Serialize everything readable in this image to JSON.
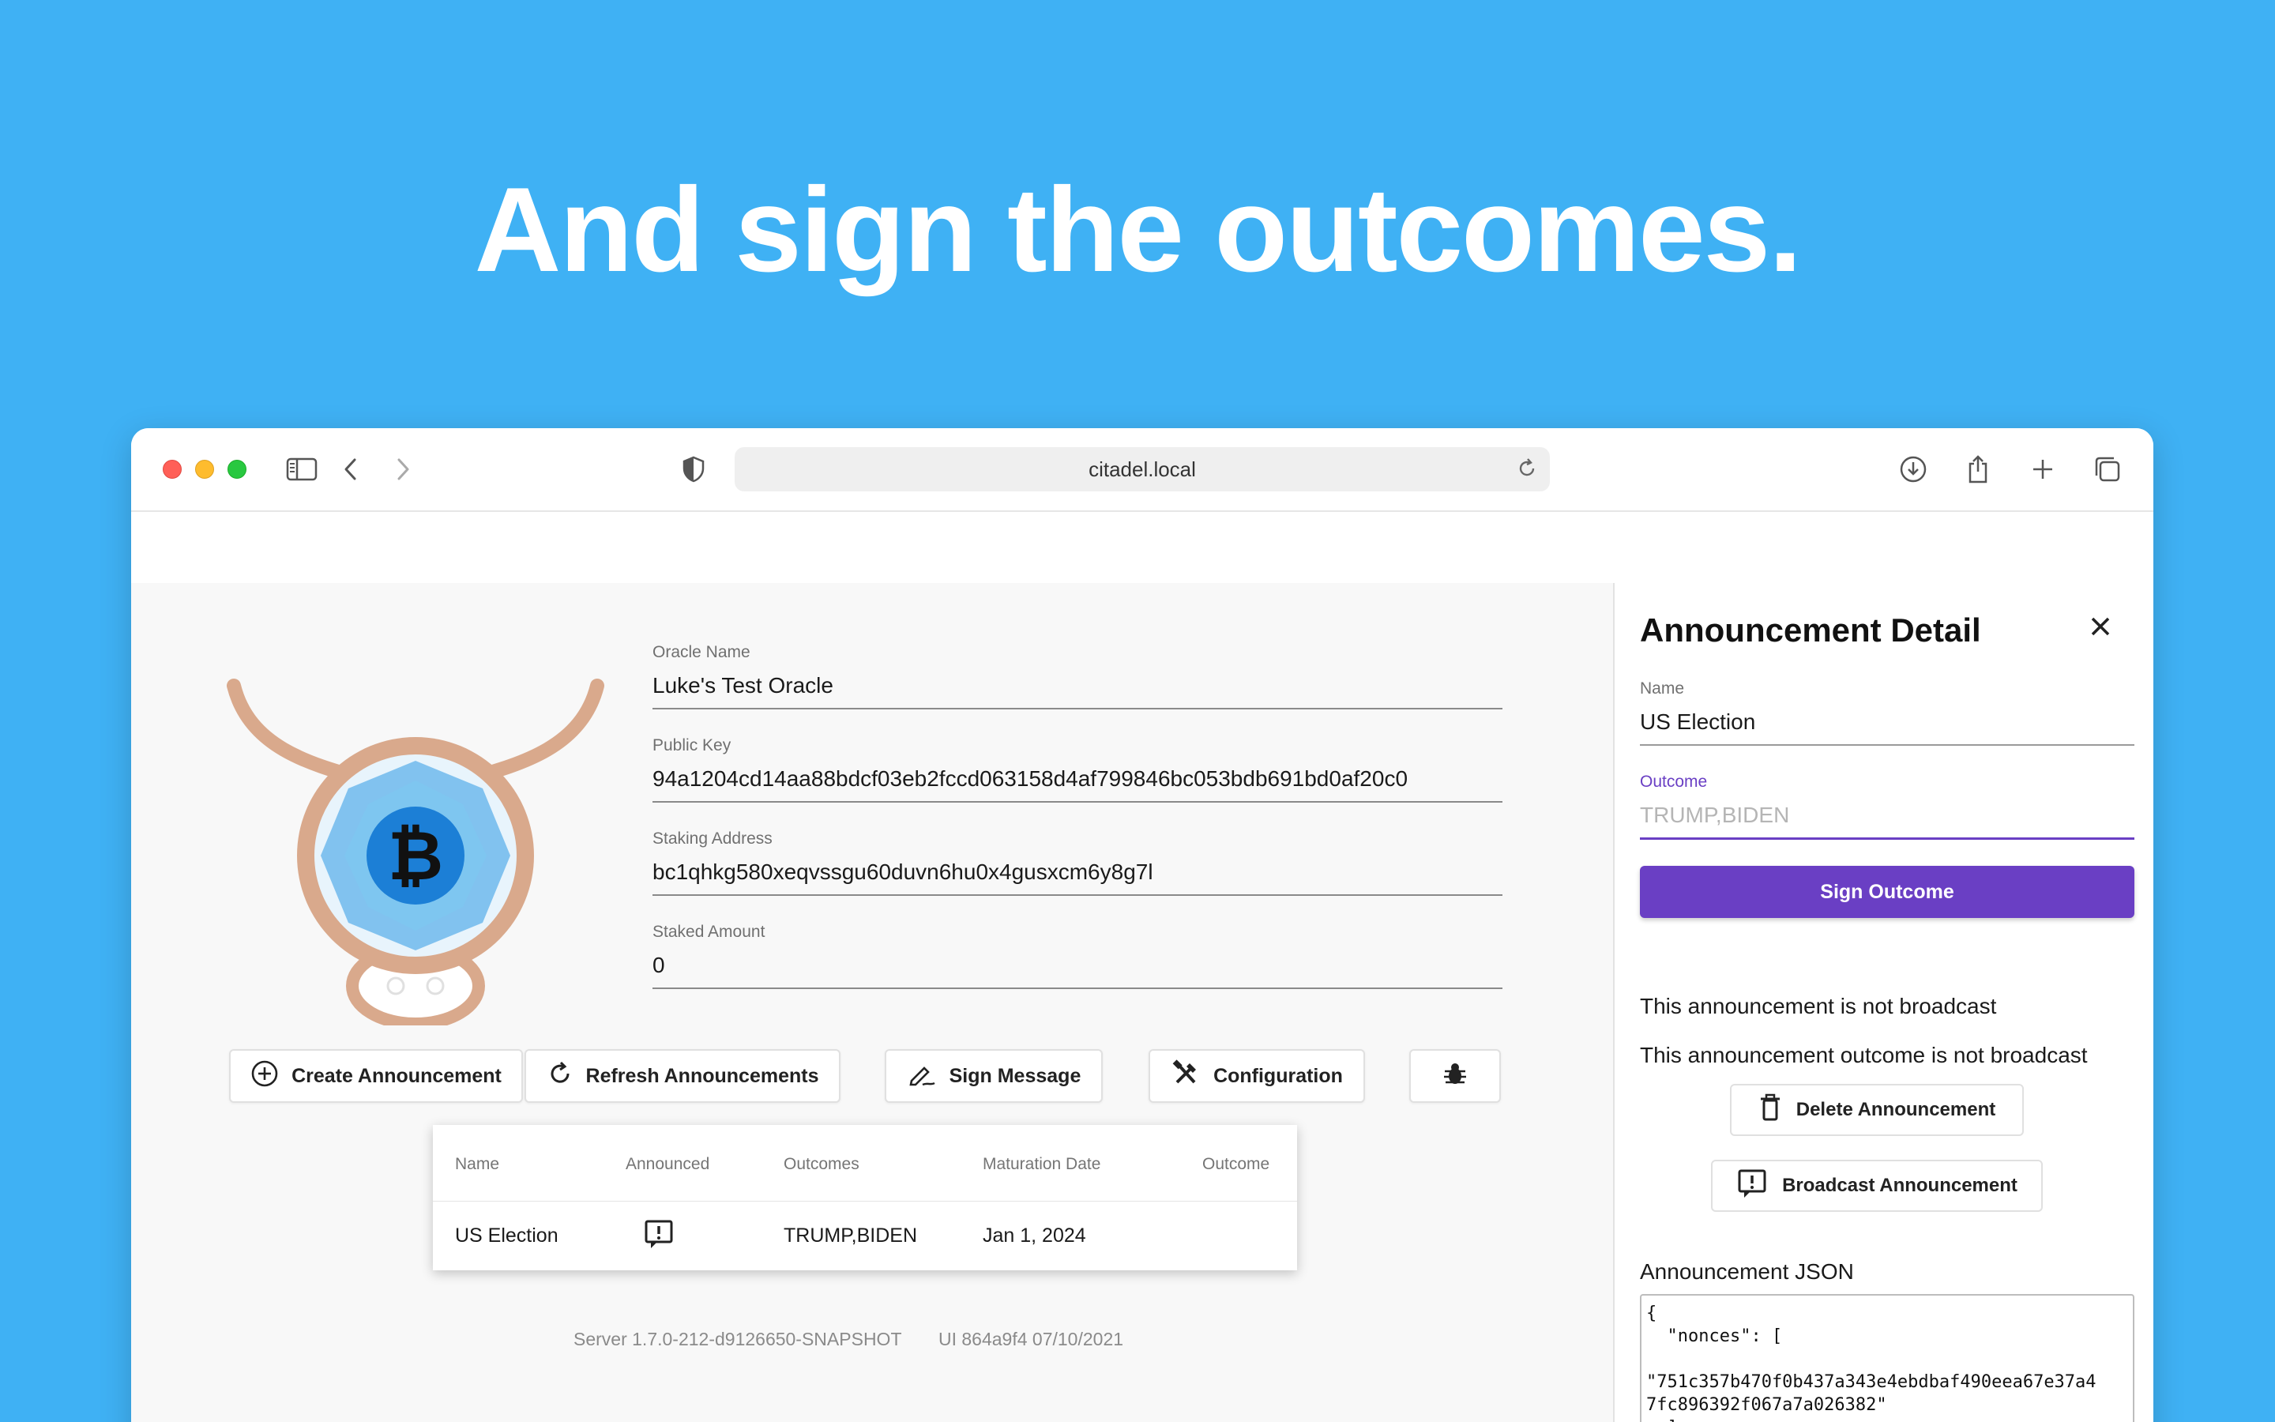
{
  "hero": {
    "headline": "And sign the outcomes."
  },
  "browser": {
    "url": "citadel.local"
  },
  "oracle": {
    "fields": [
      {
        "label": "Oracle Name",
        "value": "Luke's Test Oracle"
      },
      {
        "label": "Public Key",
        "value": "94a1204cd14aa88bdcf03eb2fccd063158d4af799846bc053bdb691bd0af20c0"
      },
      {
        "label": "Staking Address",
        "value": "bc1qhkg580xeqvssgu60duvn6hu0x4gusxcm6y8g7l"
      },
      {
        "label": "Staked Amount",
        "value": "0"
      }
    ]
  },
  "actions": {
    "create": "Create Announcement",
    "refresh": "Refresh Announcements",
    "sign_message": "Sign Message",
    "configuration": "Configuration"
  },
  "table": {
    "headers": [
      "Name",
      "Announced",
      "Outcomes",
      "Maturation Date",
      "Outcome"
    ],
    "rows": [
      {
        "name": "US Election",
        "outcomes": "TRUMP,BIDEN",
        "maturation": "Jan 1, 2024",
        "outcome": ""
      }
    ]
  },
  "footer": {
    "server": "Server 1.7.0-212-d9126650-SNAPSHOT",
    "ui": "UI 864a9f4 07/10/2021"
  },
  "panel": {
    "title": "Announcement Detail",
    "name_label": "Name",
    "name_value": "US Election",
    "outcome_label": "Outcome",
    "outcome_placeholder": "TRUMP,BIDEN",
    "sign_button": "Sign Outcome",
    "status_announcement": "This announcement is not broadcast",
    "status_outcome": "This announcement outcome is not broadcast",
    "delete_button": "Delete Announcement",
    "broadcast_button": "Broadcast Announcement",
    "json_label": "Announcement JSON",
    "json_text": "{\n  \"nonces\": [\n\n\"751c357b470f0b437a343e4ebdbaf490eea67e37a4\n7fc896392f067a7a026382\"\n  ],"
  },
  "colors": {
    "background": "#3fb1f4",
    "accent": "#6a3fc4"
  }
}
